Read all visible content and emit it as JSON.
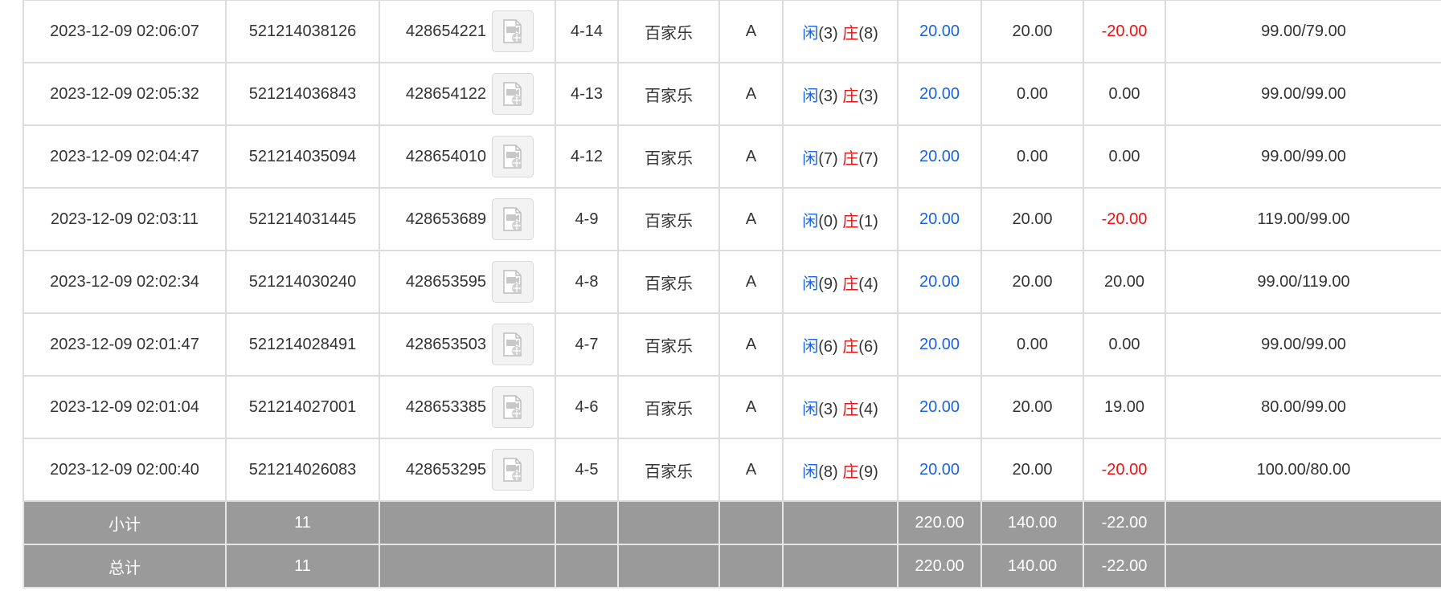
{
  "labels": {
    "player": "闲",
    "banker": "庄"
  },
  "rows": [
    {
      "time": "2023-12-09 02:06:07",
      "order": "521214038126",
      "game_id": "428654221",
      "round": "4-14",
      "game": "百家乐",
      "table": "A",
      "player_pts": "(3)",
      "banker_pts": "(8)",
      "bet": "20.00",
      "valid": "20.00",
      "win": "-20.00",
      "win_neg": true,
      "balance": "99.00/79.00"
    },
    {
      "time": "2023-12-09 02:05:32",
      "order": "521214036843",
      "game_id": "428654122",
      "round": "4-13",
      "game": "百家乐",
      "table": "A",
      "player_pts": "(3)",
      "banker_pts": "(3)",
      "bet": "20.00",
      "valid": "0.00",
      "win": "0.00",
      "win_neg": false,
      "balance": "99.00/99.00"
    },
    {
      "time": "2023-12-09 02:04:47",
      "order": "521214035094",
      "game_id": "428654010",
      "round": "4-12",
      "game": "百家乐",
      "table": "A",
      "player_pts": "(7)",
      "banker_pts": "(7)",
      "bet": "20.00",
      "valid": "0.00",
      "win": "0.00",
      "win_neg": false,
      "balance": "99.00/99.00"
    },
    {
      "time": "2023-12-09 02:03:11",
      "order": "521214031445",
      "game_id": "428653689",
      "round": "4-9",
      "game": "百家乐",
      "table": "A",
      "player_pts": "(0)",
      "banker_pts": "(1)",
      "bet": "20.00",
      "valid": "20.00",
      "win": "-20.00",
      "win_neg": true,
      "balance": "119.00/99.00"
    },
    {
      "time": "2023-12-09 02:02:34",
      "order": "521214030240",
      "game_id": "428653595",
      "round": "4-8",
      "game": "百家乐",
      "table": "A",
      "player_pts": "(9)",
      "banker_pts": "(4)",
      "bet": "20.00",
      "valid": "20.00",
      "win": "20.00",
      "win_neg": false,
      "balance": "99.00/119.00"
    },
    {
      "time": "2023-12-09 02:01:47",
      "order": "521214028491",
      "game_id": "428653503",
      "round": "4-7",
      "game": "百家乐",
      "table": "A",
      "player_pts": "(6)",
      "banker_pts": "(6)",
      "bet": "20.00",
      "valid": "0.00",
      "win": "0.00",
      "win_neg": false,
      "balance": "99.00/99.00"
    },
    {
      "time": "2023-12-09 02:01:04",
      "order": "521214027001",
      "game_id": "428653385",
      "round": "4-6",
      "game": "百家乐",
      "table": "A",
      "player_pts": "(3)",
      "banker_pts": "(4)",
      "bet": "20.00",
      "valid": "20.00",
      "win": "19.00",
      "win_neg": false,
      "balance": "80.00/99.00"
    },
    {
      "time": "2023-12-09 02:00:40",
      "order": "521214026083",
      "game_id": "428653295",
      "round": "4-5",
      "game": "百家乐",
      "table": "A",
      "player_pts": "(8)",
      "banker_pts": "(9)",
      "bet": "20.00",
      "valid": "20.00",
      "win": "-20.00",
      "win_neg": true,
      "balance": "100.00/80.00"
    }
  ],
  "subtotal": {
    "label": "小计",
    "count": "11",
    "bet": "220.00",
    "valid": "140.00",
    "win": "-22.00"
  },
  "total": {
    "label": "总计",
    "count": "11",
    "bet": "220.00",
    "valid": "140.00",
    "win": "-22.00"
  },
  "colors": {
    "player": "#1a63e0",
    "banker": "#ee1111",
    "negative": "#ee1111",
    "summary_bg": "#9a9a9a"
  },
  "icons": {
    "video_replay": "video-replay-icon"
  }
}
